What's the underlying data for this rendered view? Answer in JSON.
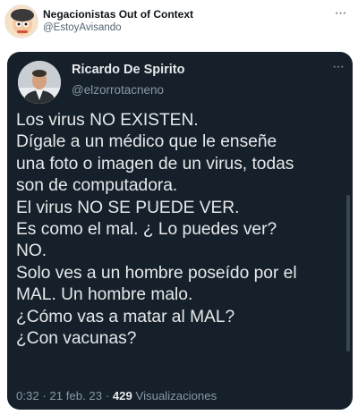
{
  "outer_tweet": {
    "name": "Negacionistas Out of Context",
    "handle": "@EstoyAvisando",
    "more_icon": "more-horizontal-icon"
  },
  "quoted_tweet": {
    "name": "Ricardo De Spirito",
    "handle": "@elzorrotacneno",
    "lines": [
      "Los virus NO EXISTEN.",
      "Dígale a un médico que le enseñe",
      "una foto o imagen de un virus, todas",
      "son de computadora.",
      "El virus NO SE PUEDE VER.",
      "Es como el mal. ¿ Lo puedes ver?",
      "NO.",
      "Solo ves a un hombre poseído por el",
      "MAL. Un hombre malo.",
      "¿Cómo vas a matar al MAL?",
      "¿Con vacunas?"
    ],
    "time": "0:32",
    "separator": "·",
    "date": "21 feb. 23",
    "views_count": "429",
    "views_label": "Visualizaciones"
  },
  "colors": {
    "card_bg": "#15202b",
    "text_primary_dark": "#e7e9ea",
    "text_secondary_dark": "#8b98a5",
    "text_primary_light": "#0f1419",
    "text_secondary_light": "#536471"
  }
}
